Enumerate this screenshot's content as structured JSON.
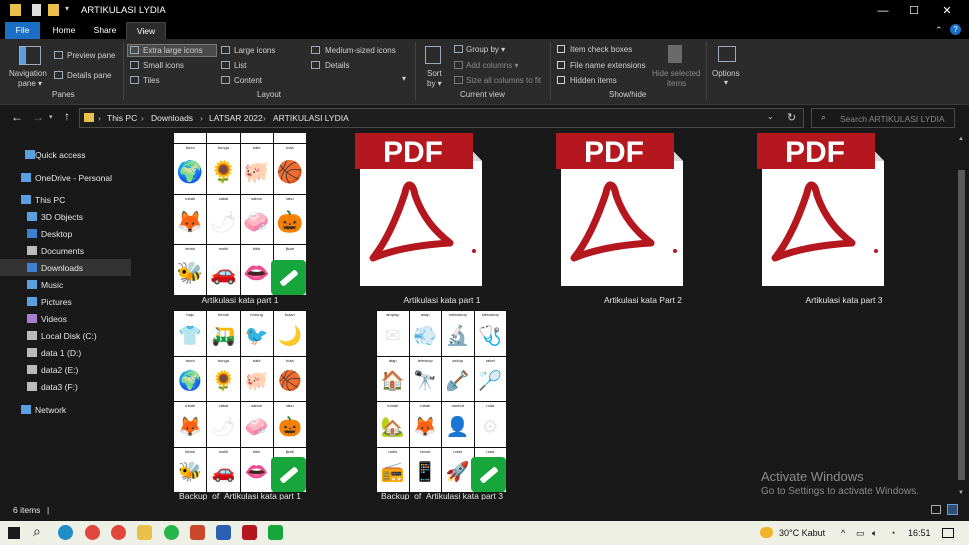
{
  "window": {
    "title": "ARTIKULASI LYDIA",
    "minimize": "—",
    "maximize": "☐",
    "close": "✕"
  },
  "ribbon_tabs": [
    "File",
    "Home",
    "Share",
    "View"
  ],
  "ribbon": {
    "panes": {
      "navigation_pane": "Navigation",
      "navigation_pane_2": "pane ▾",
      "preview_pane": "Preview pane",
      "details_pane": "Details pane",
      "group": "Panes"
    },
    "layout": {
      "extra_large": "Extra large icons",
      "large": "Large icons",
      "medium": "Medium-sized icons",
      "small": "Small icons",
      "list": "List",
      "details": "Details",
      "tiles": "Tiles",
      "content": "Content",
      "group": "Layout"
    },
    "current_view": {
      "sort_by": "Sort",
      "sort_by_2": "by ▾",
      "group_by": "Group by ▾",
      "add_columns": "Add columns ▾",
      "size_columns": "Size all columns to fit",
      "group": "Current view"
    },
    "show_hide": {
      "item_check_boxes": "Item check boxes",
      "file_name_extensions": "File name extensions",
      "hidden_items": "Hidden items",
      "hide_selected": "Hide selected",
      "hide_selected_2": "items",
      "group": "Show/hide"
    },
    "options": {
      "label": "Options",
      "label_2": "▾"
    }
  },
  "address": {
    "crumbs": [
      "This PC",
      "Downloads",
      "LATSAR 2022",
      "ARTIKULASI LYDIA"
    ],
    "search_placeholder": "Search ARTIKULASI LYDIA"
  },
  "nav": [
    {
      "label": "Quick access",
      "icon": "star-icon"
    },
    {
      "label": "OneDrive - Personal",
      "icon": "cloud-icon"
    },
    {
      "label": "This PC",
      "icon": "computer-icon"
    },
    {
      "label": "3D Objects",
      "icon": "cube-icon"
    },
    {
      "label": "Desktop",
      "icon": "desktop-icon"
    },
    {
      "label": "Documents",
      "icon": "documents-icon"
    },
    {
      "label": "Downloads",
      "icon": "download-icon"
    },
    {
      "label": "Music",
      "icon": "music-icon"
    },
    {
      "label": "Pictures",
      "icon": "pictures-icon"
    },
    {
      "label": "Videos",
      "icon": "videos-icon"
    },
    {
      "label": "Local Disk (C:)",
      "icon": "drive-icon"
    },
    {
      "label": "data 1 (D:)",
      "icon": "drive-icon"
    },
    {
      "label": "data2 (E:)",
      "icon": "drive-icon"
    },
    {
      "label": "data3 (F:)",
      "icon": "drive-icon"
    },
    {
      "label": "Network",
      "icon": "network-icon"
    }
  ],
  "files": [
    {
      "name": "Artikulasi kata part 1",
      "type": "sheet"
    },
    {
      "name": "Artikulasi kata part 1",
      "type": "pdf"
    },
    {
      "name": "Artikulasi kata Part 2",
      "type": "pdf"
    },
    {
      "name": "Artikulasi kata part 3",
      "type": "pdf"
    },
    {
      "name": "Backup_of_Artikulasi kata part 1",
      "type": "sheet"
    },
    {
      "name": "Backup_of_Artikulasi kata part 3",
      "type": "sheet"
    }
  ],
  "sheet_words_a": [
    "bumi",
    "bunga",
    "babi",
    "bola",
    "rubah",
    "cabai",
    "sabun",
    "labu",
    "lebah",
    "mobil",
    "bibir",
    "jikab"
  ],
  "sheet_words_a2": [
    "baju",
    "becak",
    "burung",
    "bulan",
    "bumi",
    "bunga",
    "babi",
    "bola",
    "rubah",
    "cabai",
    "sabun",
    "labu",
    "lebah",
    "mobil",
    "bibir",
    "jikab"
  ],
  "sheet_words_b": [
    "amplop",
    "asap",
    "mikroskop",
    "stetoskop",
    "atap",
    "teleskop",
    "sekop",
    "raket",
    "rumah",
    "rubah",
    "rambut",
    "roda",
    "radio",
    "remot",
    "roket",
    "rusa"
  ],
  "pdf_label": "PDF",
  "status": {
    "items": "6 items",
    "cursor": "|"
  },
  "watermark": {
    "line1": "Activate Windows",
    "line2": "Go to Settings to activate Windows."
  },
  "taskbar": {
    "weather": "30°C  Kabut",
    "time": "16:51"
  },
  "colors": {
    "pdf_red": "#b4171e",
    "accent": "#1a6fc4",
    "badge_green": "#17a63c"
  }
}
